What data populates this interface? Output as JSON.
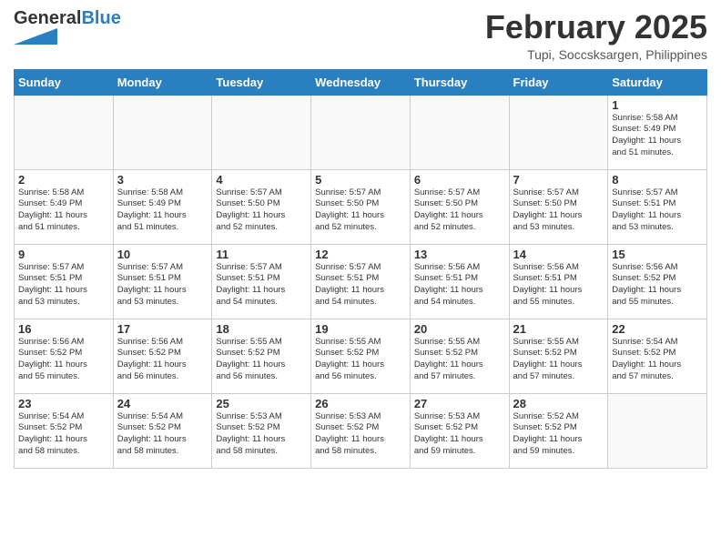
{
  "logo": {
    "general": "General",
    "blue": "Blue"
  },
  "header": {
    "month": "February 2025",
    "location": "Tupi, Soccsksargen, Philippines"
  },
  "weekdays": [
    "Sunday",
    "Monday",
    "Tuesday",
    "Wednesday",
    "Thursday",
    "Friday",
    "Saturday"
  ],
  "weeks": [
    [
      {
        "day": "",
        "sunrise": "",
        "sunset": "",
        "daylight": ""
      },
      {
        "day": "",
        "sunrise": "",
        "sunset": "",
        "daylight": ""
      },
      {
        "day": "",
        "sunrise": "",
        "sunset": "",
        "daylight": ""
      },
      {
        "day": "",
        "sunrise": "",
        "sunset": "",
        "daylight": ""
      },
      {
        "day": "",
        "sunrise": "",
        "sunset": "",
        "daylight": ""
      },
      {
        "day": "",
        "sunrise": "",
        "sunset": "",
        "daylight": ""
      },
      {
        "day": "1",
        "sunrise": "Sunrise: 5:58 AM",
        "sunset": "Sunset: 5:49 PM",
        "daylight": "Daylight: 11 hours and 51 minutes."
      }
    ],
    [
      {
        "day": "2",
        "sunrise": "Sunrise: 5:58 AM",
        "sunset": "Sunset: 5:49 PM",
        "daylight": "Daylight: 11 hours and 51 minutes."
      },
      {
        "day": "3",
        "sunrise": "Sunrise: 5:58 AM",
        "sunset": "Sunset: 5:49 PM",
        "daylight": "Daylight: 11 hours and 51 minutes."
      },
      {
        "day": "4",
        "sunrise": "Sunrise: 5:57 AM",
        "sunset": "Sunset: 5:50 PM",
        "daylight": "Daylight: 11 hours and 52 minutes."
      },
      {
        "day": "5",
        "sunrise": "Sunrise: 5:57 AM",
        "sunset": "Sunset: 5:50 PM",
        "daylight": "Daylight: 11 hours and 52 minutes."
      },
      {
        "day": "6",
        "sunrise": "Sunrise: 5:57 AM",
        "sunset": "Sunset: 5:50 PM",
        "daylight": "Daylight: 11 hours and 52 minutes."
      },
      {
        "day": "7",
        "sunrise": "Sunrise: 5:57 AM",
        "sunset": "Sunset: 5:50 PM",
        "daylight": "Daylight: 11 hours and 53 minutes."
      },
      {
        "day": "8",
        "sunrise": "Sunrise: 5:57 AM",
        "sunset": "Sunset: 5:51 PM",
        "daylight": "Daylight: 11 hours and 53 minutes."
      }
    ],
    [
      {
        "day": "9",
        "sunrise": "Sunrise: 5:57 AM",
        "sunset": "Sunset: 5:51 PM",
        "daylight": "Daylight: 11 hours and 53 minutes."
      },
      {
        "day": "10",
        "sunrise": "Sunrise: 5:57 AM",
        "sunset": "Sunset: 5:51 PM",
        "daylight": "Daylight: 11 hours and 53 minutes."
      },
      {
        "day": "11",
        "sunrise": "Sunrise: 5:57 AM",
        "sunset": "Sunset: 5:51 PM",
        "daylight": "Daylight: 11 hours and 54 minutes."
      },
      {
        "day": "12",
        "sunrise": "Sunrise: 5:57 AM",
        "sunset": "Sunset: 5:51 PM",
        "daylight": "Daylight: 11 hours and 54 minutes."
      },
      {
        "day": "13",
        "sunrise": "Sunrise: 5:56 AM",
        "sunset": "Sunset: 5:51 PM",
        "daylight": "Daylight: 11 hours and 54 minutes."
      },
      {
        "day": "14",
        "sunrise": "Sunrise: 5:56 AM",
        "sunset": "Sunset: 5:51 PM",
        "daylight": "Daylight: 11 hours and 55 minutes."
      },
      {
        "day": "15",
        "sunrise": "Sunrise: 5:56 AM",
        "sunset": "Sunset: 5:52 PM",
        "daylight": "Daylight: 11 hours and 55 minutes."
      }
    ],
    [
      {
        "day": "16",
        "sunrise": "Sunrise: 5:56 AM",
        "sunset": "Sunset: 5:52 PM",
        "daylight": "Daylight: 11 hours and 55 minutes."
      },
      {
        "day": "17",
        "sunrise": "Sunrise: 5:56 AM",
        "sunset": "Sunset: 5:52 PM",
        "daylight": "Daylight: 11 hours and 56 minutes."
      },
      {
        "day": "18",
        "sunrise": "Sunrise: 5:55 AM",
        "sunset": "Sunset: 5:52 PM",
        "daylight": "Daylight: 11 hours and 56 minutes."
      },
      {
        "day": "19",
        "sunrise": "Sunrise: 5:55 AM",
        "sunset": "Sunset: 5:52 PM",
        "daylight": "Daylight: 11 hours and 56 minutes."
      },
      {
        "day": "20",
        "sunrise": "Sunrise: 5:55 AM",
        "sunset": "Sunset: 5:52 PM",
        "daylight": "Daylight: 11 hours and 57 minutes."
      },
      {
        "day": "21",
        "sunrise": "Sunrise: 5:55 AM",
        "sunset": "Sunset: 5:52 PM",
        "daylight": "Daylight: 11 hours and 57 minutes."
      },
      {
        "day": "22",
        "sunrise": "Sunrise: 5:54 AM",
        "sunset": "Sunset: 5:52 PM",
        "daylight": "Daylight: 11 hours and 57 minutes."
      }
    ],
    [
      {
        "day": "23",
        "sunrise": "Sunrise: 5:54 AM",
        "sunset": "Sunset: 5:52 PM",
        "daylight": "Daylight: 11 hours and 58 minutes."
      },
      {
        "day": "24",
        "sunrise": "Sunrise: 5:54 AM",
        "sunset": "Sunset: 5:52 PM",
        "daylight": "Daylight: 11 hours and 58 minutes."
      },
      {
        "day": "25",
        "sunrise": "Sunrise: 5:53 AM",
        "sunset": "Sunset: 5:52 PM",
        "daylight": "Daylight: 11 hours and 58 minutes."
      },
      {
        "day": "26",
        "sunrise": "Sunrise: 5:53 AM",
        "sunset": "Sunset: 5:52 PM",
        "daylight": "Daylight: 11 hours and 58 minutes."
      },
      {
        "day": "27",
        "sunrise": "Sunrise: 5:53 AM",
        "sunset": "Sunset: 5:52 PM",
        "daylight": "Daylight: 11 hours and 59 minutes."
      },
      {
        "day": "28",
        "sunrise": "Sunrise: 5:52 AM",
        "sunset": "Sunset: 5:52 PM",
        "daylight": "Daylight: 11 hours and 59 minutes."
      },
      {
        "day": "",
        "sunrise": "",
        "sunset": "",
        "daylight": ""
      }
    ]
  ]
}
